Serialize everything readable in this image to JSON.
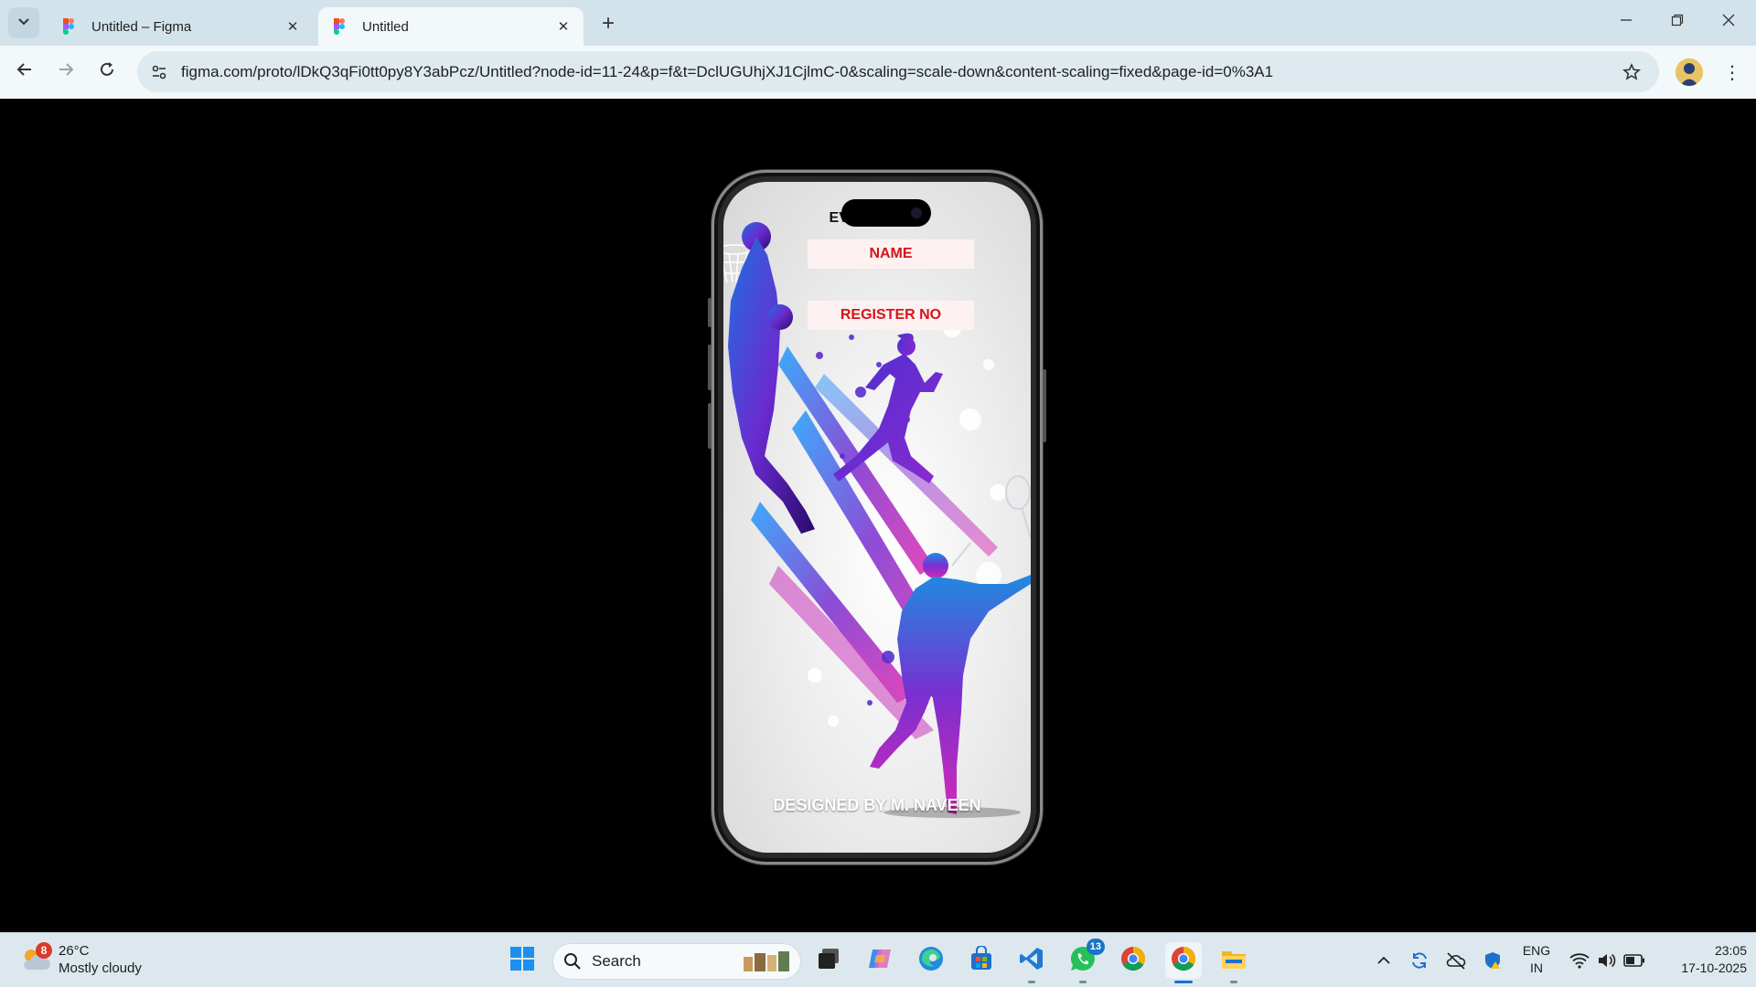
{
  "browser": {
    "tabs": [
      {
        "title": "Untitled – Figma",
        "active": false
      },
      {
        "title": "Untitled",
        "active": true
      }
    ],
    "url": "figma.com/proto/lDkQ3qFi0tt0py8Y3abPcz/Untitled?node-id=11-24&p=f&t=DclUGUhjXJ1CjlmC-0&scaling=scale-down&content-scaling=fixed&page-id=0%3A1"
  },
  "prototype": {
    "form_title": "EVENT FORM",
    "field_name": "NAME",
    "field_register": "REGISTER NO",
    "credit": "DESIGNED BY M. NAVEEN"
  },
  "taskbar": {
    "weather": {
      "badge": "8",
      "temp": "26°C",
      "condition": "Mostly cloudy"
    },
    "search_label": "Search",
    "whatsapp_badge": "13",
    "lang_line1": "ENG",
    "lang_line2": "IN",
    "time": "23:05",
    "date": "17-10-2025"
  },
  "colors": {
    "tabstrip": "#d3e3ec",
    "toolbar": "#f3f8fb",
    "field_bg": "#fdf1f1",
    "field_text": "#d4141c",
    "accent_purple": "#7a2fd0",
    "accent_blue": "#1f6fe0",
    "accent_magenta": "#d22ab8"
  },
  "icons": [
    "tab-list-icon",
    "figma-icon",
    "close-icon",
    "plus-icon",
    "minimize-icon",
    "restore-icon",
    "window-close-icon",
    "back-icon",
    "forward-icon",
    "reload-icon",
    "site-info-icon",
    "star-icon",
    "kebab-icon",
    "weather-icon",
    "windows-start-icon",
    "search-icon",
    "task-view-icon",
    "copilot-icon",
    "edge-icon",
    "store-icon",
    "vscode-icon",
    "whatsapp-icon",
    "chrome-icon",
    "file-explorer-icon",
    "chevron-up-icon",
    "sync-icon",
    "cloud-off-icon",
    "defender-icon",
    "wifi-icon",
    "volume-icon",
    "battery-icon"
  ]
}
